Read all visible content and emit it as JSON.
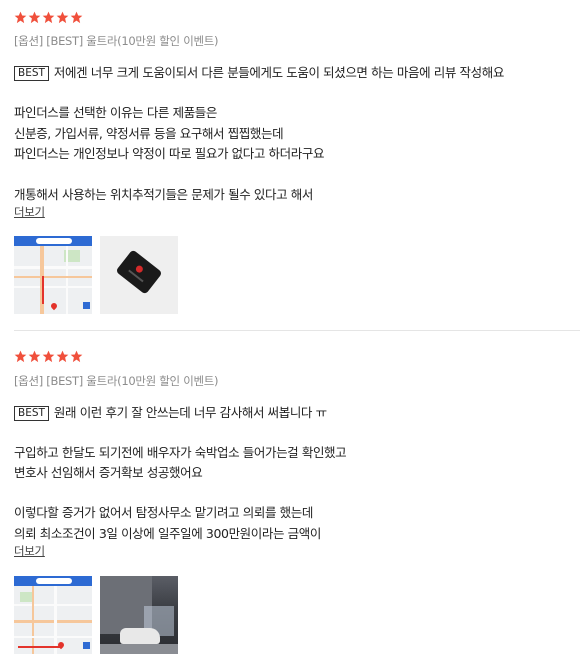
{
  "reviews": [
    {
      "rating": 5,
      "option": "[옵션] [BEST] 울트라(10만원 할인 이벤트)",
      "badge": "BEST",
      "lines": [
        "저에겐 너무 크게 도움이되서 다른 분들에게도 도움이 되셨으면 하는 마음에 리뷰 작성해요",
        "파인더스를 선택한 이유는 다른 제품들은",
        "신분증, 가입서류, 약정서류 등을 요구해서 찝찝했는데",
        "파인더스는 개인정보나 약정이 따로 필요가 없다고 하더라구요",
        "개통해서 사용하는 위치추적기들은 문제가 될수 있다고 해서"
      ],
      "more": "더보기"
    },
    {
      "rating": 5,
      "option": "[옵션] [BEST] 울트라(10만원 할인 이벤트)",
      "badge": "BEST",
      "lines": [
        "원래 이런 후기 잘 안쓰는데 너무 감사해서 써봅니다 ㅠ",
        "구입하고 한달도 되기전에 배우자가 숙박업소 들어가는걸 확인했고",
        "변호사 선임해서 증거확보 성공했어요",
        "이렇다할 증거가 없어서 탐정사무소 맡기려고 의뢰를 했는데",
        "의뢰 최소조건이 3일 이상에 일주일에 300만원이라는 금액이"
      ],
      "more": "더보기"
    }
  ],
  "colors": {
    "star": "#f0503c",
    "map_accent": "#2d6ad3"
  },
  "icons": {
    "star": "star-icon"
  }
}
